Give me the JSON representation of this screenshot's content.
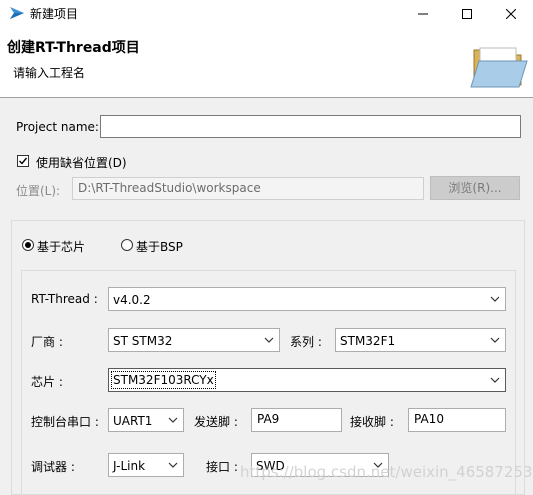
{
  "window": {
    "title": "新建项目",
    "app_icon": "rt-thread-studio-icon",
    "buttons": [
      "minimize-icon",
      "maximize-icon",
      "close-icon"
    ]
  },
  "banner": {
    "title": "创建RT-Thread项目",
    "subtitle": "请输入工程名",
    "icon": "open-folder-icon"
  },
  "form": {
    "project_name_label": "Project name:",
    "project_name_value": "",
    "use_default_location_label": "使用缺省位置(D)",
    "use_default_location_checked": true,
    "location_label": "位置(L):",
    "location_value": "D:\\RT-ThreadStudio\\workspace",
    "browse_label": "浏览(R)..."
  },
  "mode": {
    "chip_label": "基于芯片",
    "bsp_label": "基于BSP",
    "selected": "chip"
  },
  "chip_config": {
    "rtthread_label": "RT-Thread :",
    "rtthread_value": "v4.0.2",
    "vendor_label": "厂商 :",
    "vendor_value": "ST STM32",
    "series_label": "系列 :",
    "series_value": "STM32F1",
    "chip_label": "芯片 :",
    "chip_value": "STM32F103RCYx",
    "console_label": "控制台串口 :",
    "console_value": "UART1",
    "tx_label": "发送脚 :",
    "tx_value": "PA9",
    "rx_label": "接收脚 :",
    "rx_value": "PA10",
    "debugger_label": "调试器 :",
    "debugger_value": "J-Link",
    "interface_label": "接口 :",
    "interface_value": "SWD"
  },
  "watermark": "https://blog.csdn.net/weixin_46587253"
}
